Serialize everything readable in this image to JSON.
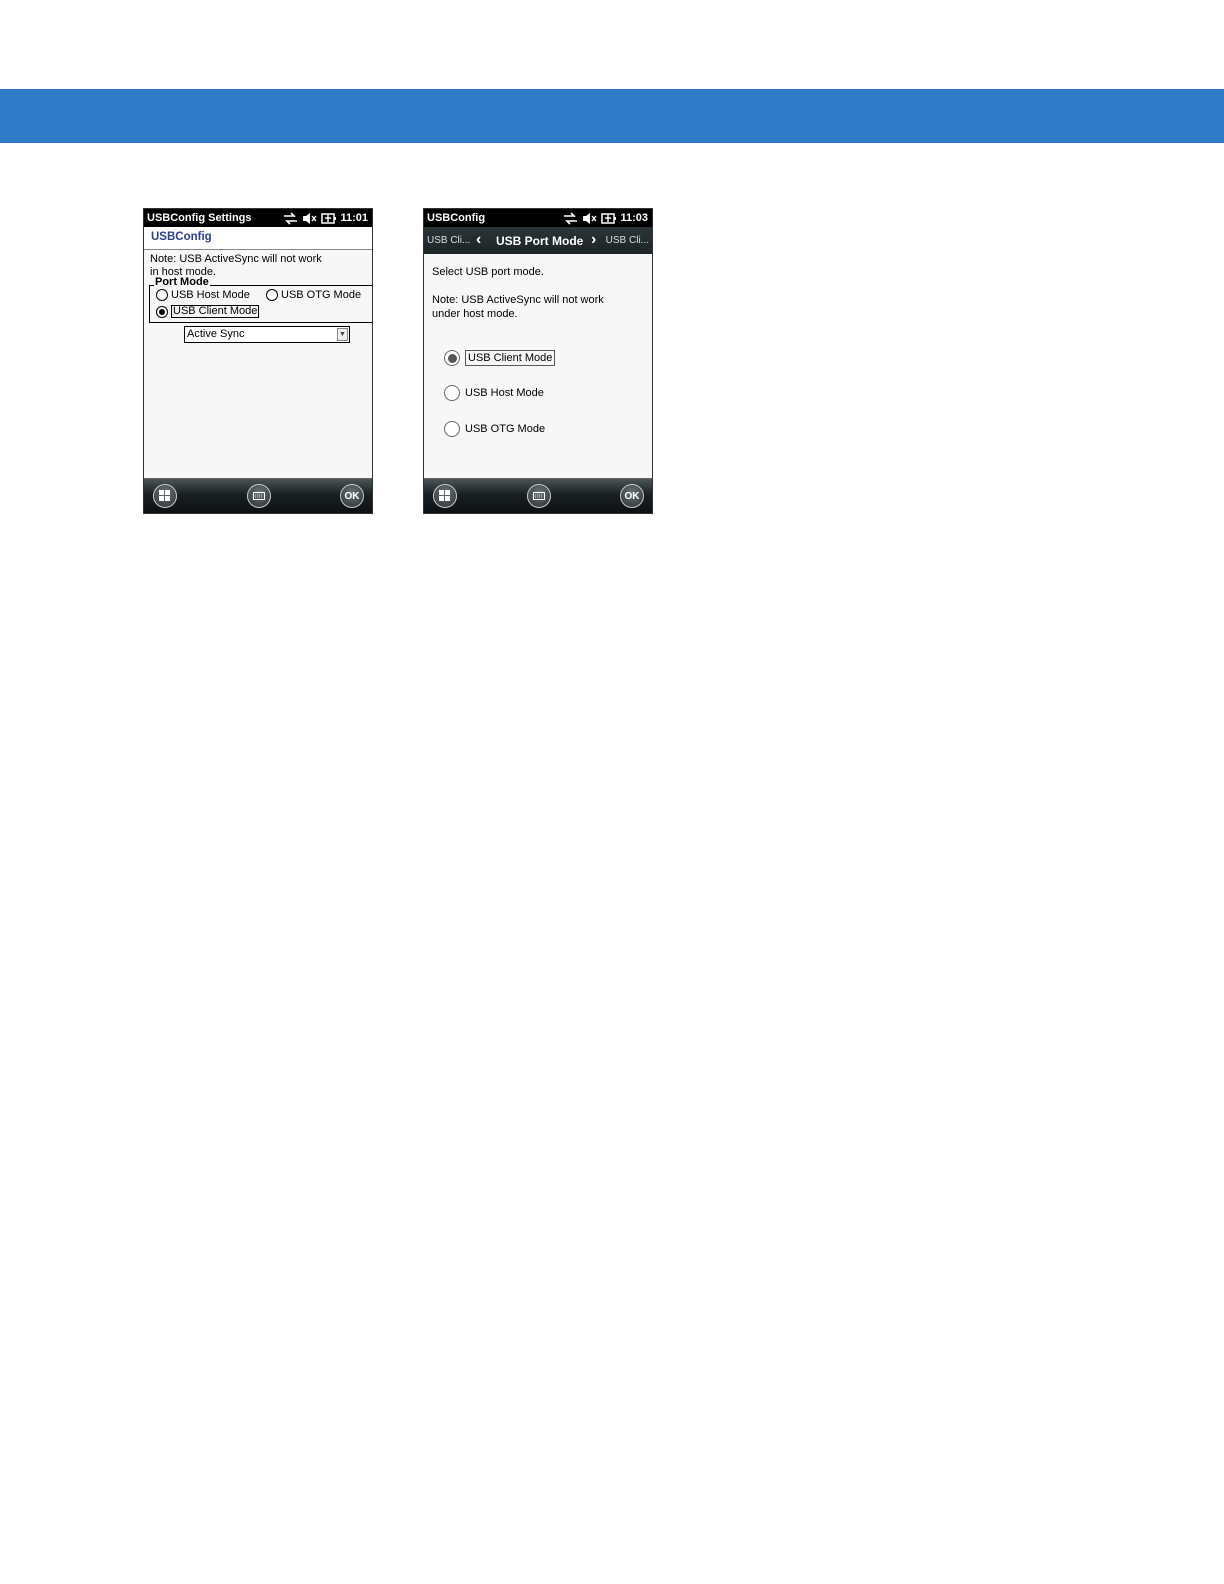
{
  "phone1": {
    "status_title": "USBConfig Settings",
    "time": "11:01",
    "header": "USBConfig",
    "note_line1": "Note: USB ActiveSync will not work",
    "note_line2": "in host mode.",
    "group_label": "Port Mode",
    "radio_host": "USB Host Mode",
    "radio_otg": "USB OTG Mode",
    "radio_client": "USB Client Mode",
    "selected": "USB Client Mode",
    "combo_value": "Active Sync",
    "ok_label": "OK"
  },
  "phone2": {
    "status_title": "USBConfig",
    "time": "11:03",
    "nav_prev": "USB Cli...",
    "nav_current": "USB Port Mode",
    "nav_next": "USB Cli...",
    "instruction": "Select USB port mode.",
    "note_line1": "Note: USB ActiveSync will not work",
    "note_line2": "under host mode.",
    "radio_client": "USB Client Mode",
    "radio_host": "USB Host Mode",
    "radio_otg": "USB OTG Mode",
    "selected": "USB Client Mode",
    "ok_label": "OK"
  },
  "colors": {
    "banner": "#2f7bc8",
    "header_text": "#2a3f8f"
  },
  "icons": [
    "connectivity-icon",
    "speaker-muted-icon",
    "battery-charging-icon",
    "windows-start-icon",
    "keyboard-icon"
  ]
}
